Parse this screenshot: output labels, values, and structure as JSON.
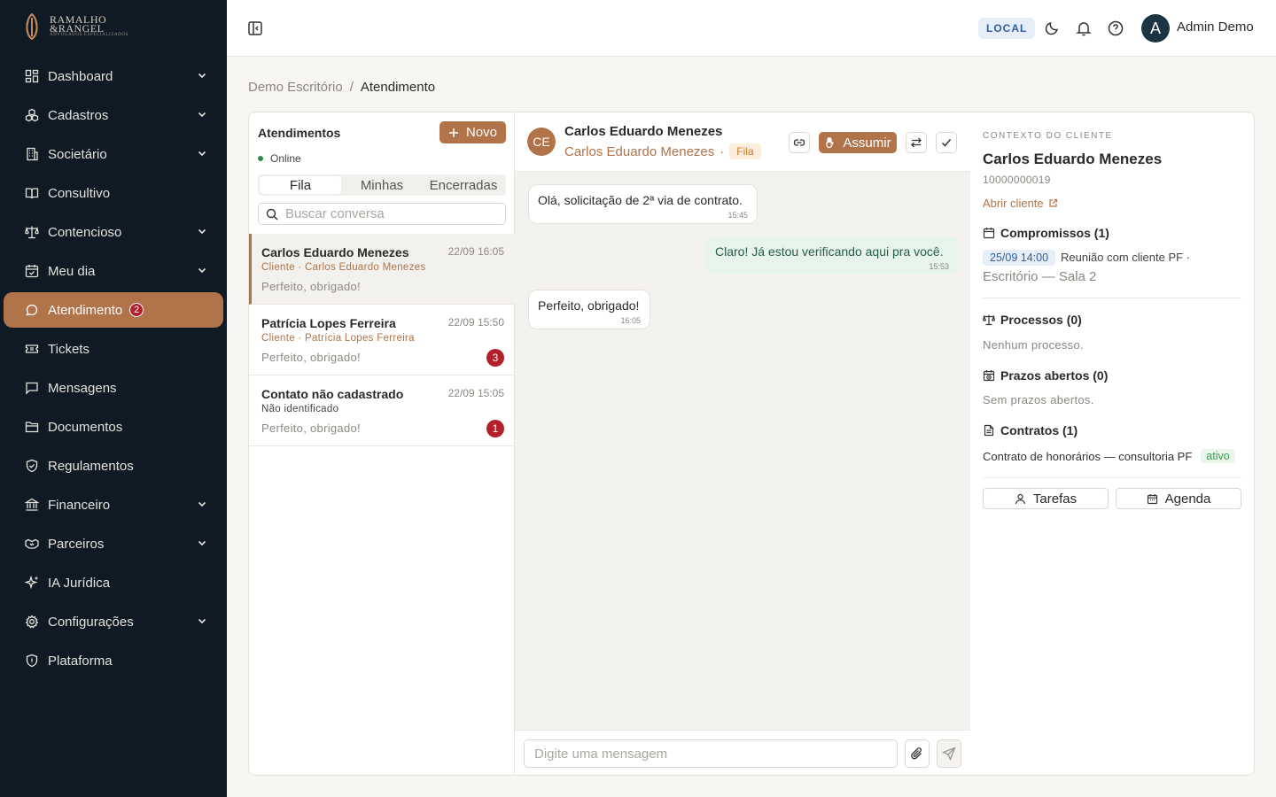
{
  "brand": {
    "line1": "RAMALHO",
    "line2": "&RANGEL",
    "line3": "ADVOGADOS ESPECIALIZADOS"
  },
  "sidebar": {
    "items": [
      {
        "label": "Dashboard",
        "icon": "dashboard-icon",
        "expandable": true
      },
      {
        "label": "Cadastros",
        "icon": "boxes-icon",
        "expandable": true
      },
      {
        "label": "Societário",
        "icon": "building-icon",
        "expandable": true
      },
      {
        "label": "Consultivo",
        "icon": "book-icon",
        "expandable": false
      },
      {
        "label": "Contencioso",
        "icon": "scale-icon",
        "expandable": true
      },
      {
        "label": "Meu dia",
        "icon": "calendar-check-icon",
        "expandable": true
      },
      {
        "label": "Atendimento",
        "icon": "message-circle-icon",
        "expandable": false,
        "active": true,
        "badge": "2"
      },
      {
        "label": "Tickets",
        "icon": "ticket-icon",
        "expandable": false
      },
      {
        "label": "Mensagens",
        "icon": "message-square-icon",
        "expandable": false
      },
      {
        "label": "Documentos",
        "icon": "folder-icon",
        "expandable": false
      },
      {
        "label": "Regulamentos",
        "icon": "shield-check-icon",
        "expandable": false
      },
      {
        "label": "Financeiro",
        "icon": "bank-icon",
        "expandable": true
      },
      {
        "label": "Parceiros",
        "icon": "handshake-icon",
        "expandable": true
      },
      {
        "label": "IA Jurídica",
        "icon": "sparkles-icon",
        "expandable": false
      },
      {
        "label": "Configurações",
        "icon": "gear-icon",
        "expandable": true
      },
      {
        "label": "Plataforma",
        "icon": "shield-icon",
        "expandable": false
      }
    ]
  },
  "header": {
    "env_badge": "LOCAL",
    "user_initial": "A",
    "user_name": "Admin Demo"
  },
  "breadcrumb": {
    "root": "Demo Escritório",
    "separator": "/",
    "current": "Atendimento"
  },
  "list": {
    "title": "Atendimentos",
    "new_label": "Novo",
    "status": "Online",
    "tabs": [
      "Fila",
      "Minhas",
      "Encerradas"
    ],
    "active_tab": "Fila",
    "search_placeholder": "Buscar conversa",
    "conversations": [
      {
        "name": "Carlos Eduardo Menezes",
        "time": "22/09 16:05",
        "sub": "Cliente · Carlos Eduardo Menezes",
        "preview": "Perfeito, obrigado!",
        "unread": ""
      },
      {
        "name": "Patrícia Lopes Ferreira",
        "time": "22/09 15:50",
        "sub": "Cliente · Patrícia Lopes Ferreira",
        "preview": "Perfeito, obrigado!",
        "unread": "3"
      },
      {
        "name": "Contato não cadastrado",
        "time": "22/09 15:05",
        "sub": "Não identificado",
        "preview": "Perfeito, obrigado!",
        "unread": "1"
      }
    ]
  },
  "chat": {
    "initials": "CE",
    "name": "Carlos Eduardo Menezes",
    "sub_name": "Carlos Eduardo Menezes",
    "sub_sep": "·",
    "queue_tag": "Fila",
    "assume_label": "Assumir",
    "messages": [
      {
        "text": "Olá, solicitação de 2ª via de contrato.",
        "time": "15:45",
        "direction": "in"
      },
      {
        "text": "Claro! Já estou verificando aqui pra você.",
        "time": "15:53",
        "direction": "out"
      },
      {
        "text": "Perfeito, obrigado!",
        "time": "16:05",
        "direction": "in"
      }
    ],
    "composer_placeholder": "Digite uma mensagem"
  },
  "context": {
    "kicker": "CONTEXTO DO CLIENTE",
    "name": "Carlos Eduardo Menezes",
    "id": "10000000019",
    "open_link": "Abrir cliente",
    "appointments_title": "Compromissos (1)",
    "appointment": {
      "date": "25/09 14:00",
      "title": "Reunião com cliente PF ·",
      "location": "Escritório — Sala 2"
    },
    "processes_title": "Processos (0)",
    "processes_empty": "Nenhum processo.",
    "deadlines_title": "Prazos abertos (0)",
    "deadlines_empty": "Sem prazos abertos.",
    "contracts_title": "Contratos (1)",
    "contract": {
      "name": "Contrato de honorários — consultoria PF",
      "status": "ativo"
    },
    "tasks_label": "Tarefas",
    "agenda_label": "Agenda"
  },
  "colors": {
    "sidebar_bg": "#0f1a24",
    "accent": "#b0734a",
    "badge_red": "#b2202b",
    "online_green": "#2a8a4a"
  }
}
